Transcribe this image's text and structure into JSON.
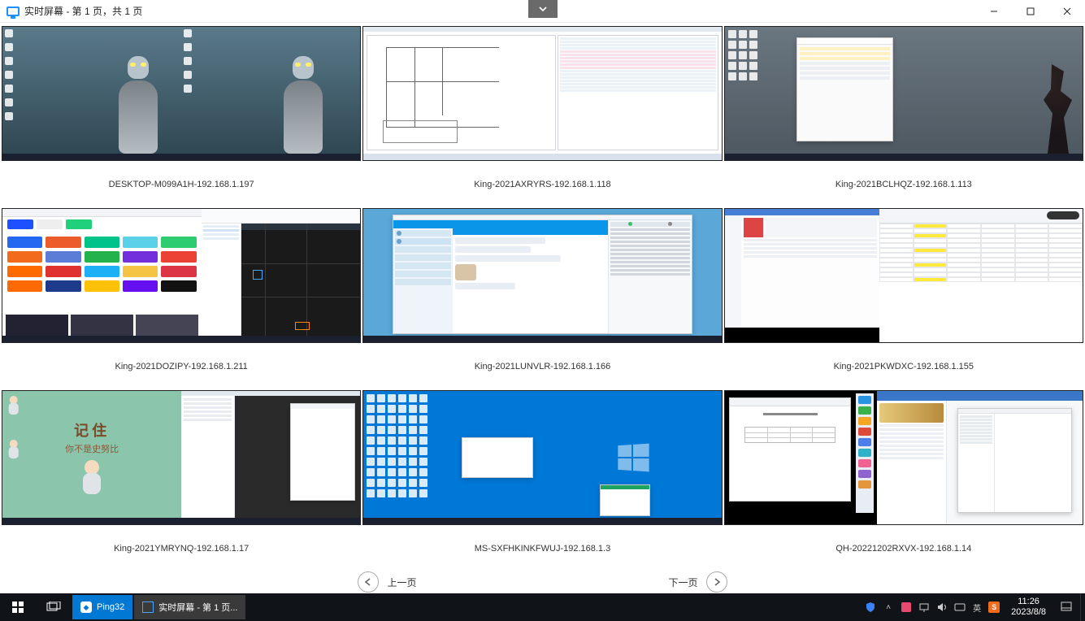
{
  "window": {
    "title": "实时屏幕 - 第 1 页，共 1 页"
  },
  "screens": [
    {
      "label": "DESKTOP-M099A1H-192.168.1.197"
    },
    {
      "label": "King-2021AXRYRS-192.168.1.118"
    },
    {
      "label": "King-2021BCLHQZ-192.168.1.113"
    },
    {
      "label": "King-2021DOZIPY-192.168.1.211"
    },
    {
      "label": "King-2021LUNVLR-192.168.1.166"
    },
    {
      "label": "King-2021PKWDXC-192.168.1.155"
    },
    {
      "label": "King-2021YMRYNQ-192.168.1.17"
    },
    {
      "label": "MS-SXFHKINKFWUJ-192.168.1.3"
    },
    {
      "label": "QH-20221202RXVX-192.168.1.14"
    }
  ],
  "pager": {
    "prev": "上一页",
    "next": "下一页"
  },
  "taskbar": {
    "app1": "Ping32",
    "app2": "实时屏幕 - 第 1 页...",
    "ime": "英",
    "time": "11:26",
    "date": "2023/8/8"
  },
  "thumb": {
    "cartoon_title": "记住",
    "cartoon_sub": "你不是史努比"
  }
}
